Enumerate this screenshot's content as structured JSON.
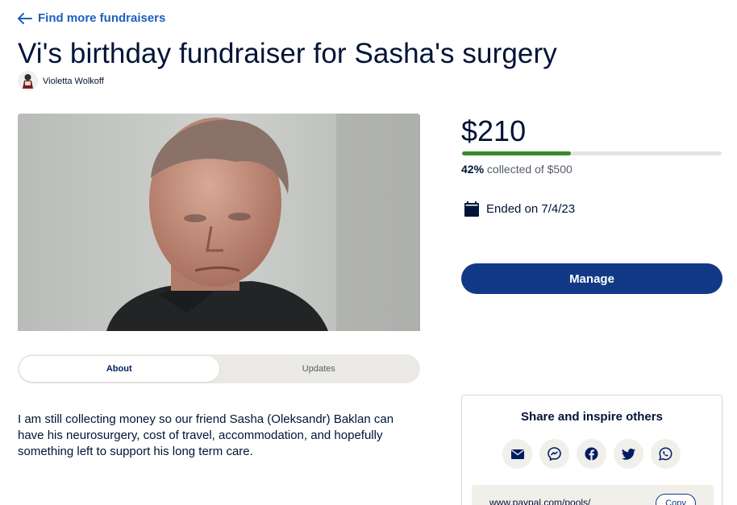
{
  "nav": {
    "back_label": "Find more fundraisers"
  },
  "fundraiser": {
    "title": "Vi's birthday fundraiser for Sasha's surgery",
    "organizer": "Violetta Wolkoff",
    "description": "I am still collecting money so our friend Sasha (Oleksandr) Baklan can have his neurosurgery, cost of travel, accommodation, and hopefully something left to support his long term care."
  },
  "tabs": [
    {
      "label": "About",
      "active": true
    },
    {
      "label": "Updates",
      "active": false
    }
  ],
  "progress": {
    "amount": "$210",
    "percent_label": "42%",
    "collected_text": "collected of $500",
    "fraction": 0.42
  },
  "status": {
    "ended_text": "Ended on 7/4/23"
  },
  "actions": {
    "manage_label": "Manage"
  },
  "share": {
    "title": "Share and inspire others",
    "icons": [
      "email-icon",
      "messenger-icon",
      "facebook-icon",
      "twitter-icon",
      "whatsapp-icon"
    ],
    "link": "www.paypal.com/pools/",
    "copy_label": "Copy"
  },
  "colors": {
    "primary": "#113985",
    "link": "#1d5fbd",
    "progress": "#3a8a2a"
  }
}
